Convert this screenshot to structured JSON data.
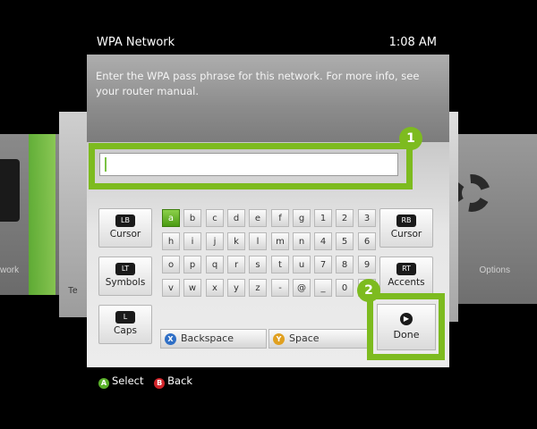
{
  "window": {
    "title": "WPA Network",
    "clock": "1:08  AM"
  },
  "background": {
    "left_label": "work",
    "left_label2": "Te",
    "right_label": "Options"
  },
  "dialog": {
    "prompt": "Enter the WPA pass phrase for this network. For more info, see your router manual.",
    "input_value": ""
  },
  "annotations": {
    "badge1": "1",
    "badge2": "2",
    "accent": "#7dbb1f"
  },
  "side_buttons": {
    "cursor_left": {
      "label": "Cursor",
      "icon": "LB"
    },
    "cursor_right": {
      "label": "Cursor",
      "icon": "RB"
    },
    "symbols": {
      "label": "Symbols",
      "icon": "LT"
    },
    "accents": {
      "label": "Accents",
      "icon": "RT"
    },
    "caps": {
      "label": "Caps",
      "icon": "L"
    }
  },
  "keys": {
    "row1": [
      "a",
      "b",
      "c",
      "d",
      "e",
      "f",
      "g",
      "1",
      "2",
      "3"
    ],
    "row2": [
      "h",
      "i",
      "j",
      "k",
      "l",
      "m",
      "n",
      "4",
      "5",
      "6"
    ],
    "row3": [
      "o",
      "p",
      "q",
      "r",
      "s",
      "t",
      "u",
      "7",
      "8",
      "9"
    ],
    "row4": [
      "v",
      "w",
      "x",
      "y",
      "z",
      "-",
      "@",
      "_",
      "0",
      "."
    ]
  },
  "bottom_keys": {
    "backspace": {
      "label": "Backspace",
      "glyph": "X",
      "color": "#2f6fc6"
    },
    "space": {
      "label": "Space",
      "glyph": "Y",
      "color": "#e0a020"
    },
    "done": {
      "label": "Done",
      "glyph": "▶"
    }
  },
  "footer": {
    "select": {
      "glyph": "A",
      "label": "Select",
      "color": "#5ab02a"
    },
    "back": {
      "glyph": "B",
      "label": "Back",
      "color": "#d0242a"
    }
  }
}
